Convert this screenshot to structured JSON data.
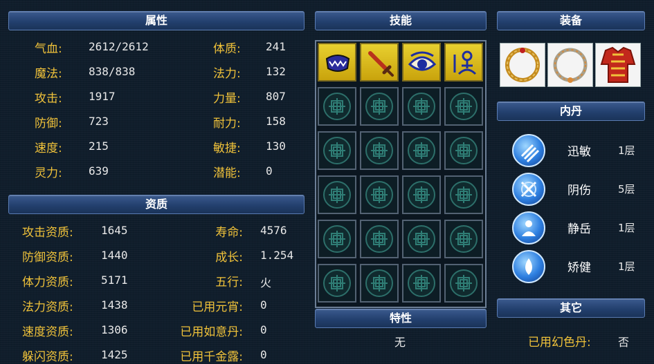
{
  "headers": {
    "attributes": "属性",
    "skills": "技能",
    "equipment": "装备",
    "aptitude": "资质",
    "inner_core": "内丹",
    "traits": "特性",
    "other": "其它"
  },
  "attributes_left": [
    {
      "label": "气血:",
      "value": "2612/2612"
    },
    {
      "label": "魔法:",
      "value": "838/838"
    },
    {
      "label": "攻击:",
      "value": "1917"
    },
    {
      "label": "防御:",
      "value": "723"
    },
    {
      "label": "速度:",
      "value": "215"
    },
    {
      "label": "灵力:",
      "value": "639"
    }
  ],
  "attributes_right": [
    {
      "label": "体质:",
      "value": "241"
    },
    {
      "label": "法力:",
      "value": "132"
    },
    {
      "label": "力量:",
      "value": "807"
    },
    {
      "label": "耐力:",
      "value": "158"
    },
    {
      "label": "敏捷:",
      "value": "130"
    },
    {
      "label": "潜能:",
      "value": "0"
    }
  ],
  "aptitude_left": [
    {
      "label": "攻击资质:",
      "value": "1645"
    },
    {
      "label": "防御资质:",
      "value": "1440"
    },
    {
      "label": "体力资质:",
      "value": "5171"
    },
    {
      "label": "法力资质:",
      "value": "1438"
    },
    {
      "label": "速度资质:",
      "value": "1306"
    },
    {
      "label": "躲闪资质:",
      "value": "1425"
    }
  ],
  "aptitude_right": [
    {
      "label": "寿命:",
      "value": "4576"
    },
    {
      "label": "成长:",
      "value": "1.254"
    },
    {
      "label": "五行:",
      "value": "火"
    },
    {
      "label": "已用元宵:",
      "value": "0"
    },
    {
      "label": "已用如意丹:",
      "value": "0"
    },
    {
      "label": "已用千金露:",
      "value": "0"
    }
  ],
  "skills": [
    {
      "icon": "mouth-icon"
    },
    {
      "icon": "sword-icon"
    },
    {
      "icon": "eye-icon"
    },
    {
      "icon": "meditate-icon"
    }
  ],
  "equipment": [
    {
      "icon": "ring-icon"
    },
    {
      "icon": "necklace-icon"
    },
    {
      "icon": "armor-icon"
    }
  ],
  "inner_core": [
    {
      "name": "迅敏",
      "level": "1层"
    },
    {
      "name": "阴伤",
      "level": "5层"
    },
    {
      "name": "静岳",
      "level": "1层"
    },
    {
      "name": "矫健",
      "level": "1层"
    }
  ],
  "traits": {
    "value": "无"
  },
  "other": {
    "label": "已用幻色丹:",
    "value": "否"
  },
  "colors": {
    "label": "#f0c23a",
    "header": "#23406e",
    "skill_slot": "#e8d030"
  }
}
